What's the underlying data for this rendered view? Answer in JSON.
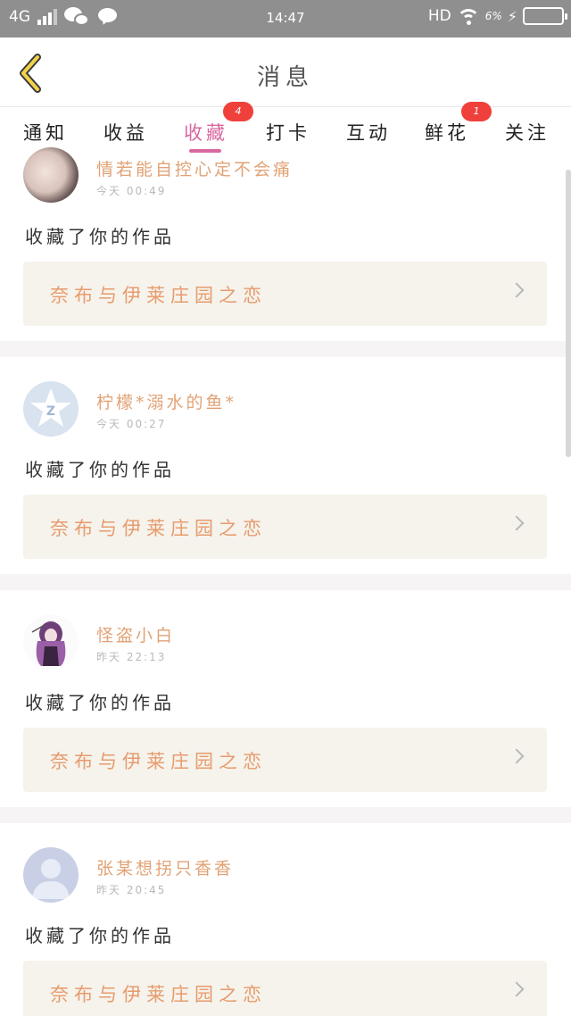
{
  "status_bar": {
    "network": "4G",
    "time": "14:47",
    "hd": "HD",
    "battery_percent": "6%"
  },
  "header": {
    "title": "消息"
  },
  "tabs": [
    {
      "label": "通知"
    },
    {
      "label": "收益"
    },
    {
      "label": "收藏",
      "badge": "4",
      "active": true
    },
    {
      "label": "打卡"
    },
    {
      "label": "互动"
    },
    {
      "label": "鲜花",
      "badge": "1"
    },
    {
      "label": "关注"
    }
  ],
  "colors": {
    "accent_pink": "#d9689f",
    "name_orange": "#e2a275",
    "badge_red": "#f0403c",
    "back_arrow_yellow": "#f2d24a"
  },
  "notifications": [
    {
      "user": "情若能自控心定不会痛",
      "time": "今天 00:49",
      "action": "收藏了你的作品",
      "work": "奈布与伊莱庄园之恋",
      "avatar": "photo-avatar"
    },
    {
      "user": "柠檬*溺水的鱼*",
      "time": "今天 00:27",
      "action": "收藏了你的作品",
      "work": "奈布与伊莱庄园之恋",
      "avatar": "qq-star-avatar"
    },
    {
      "user": "怪盗小白",
      "time": "昨天 22:13",
      "action": "收藏了你的作品",
      "work": "奈布与伊莱庄园之恋",
      "avatar": "anime-avatar"
    },
    {
      "user": "张某想拐只香香",
      "time": "昨天 20:45",
      "action": "收藏了你的作品",
      "work": "奈布与伊莱庄园之恋",
      "avatar": "default-person-avatar"
    }
  ]
}
